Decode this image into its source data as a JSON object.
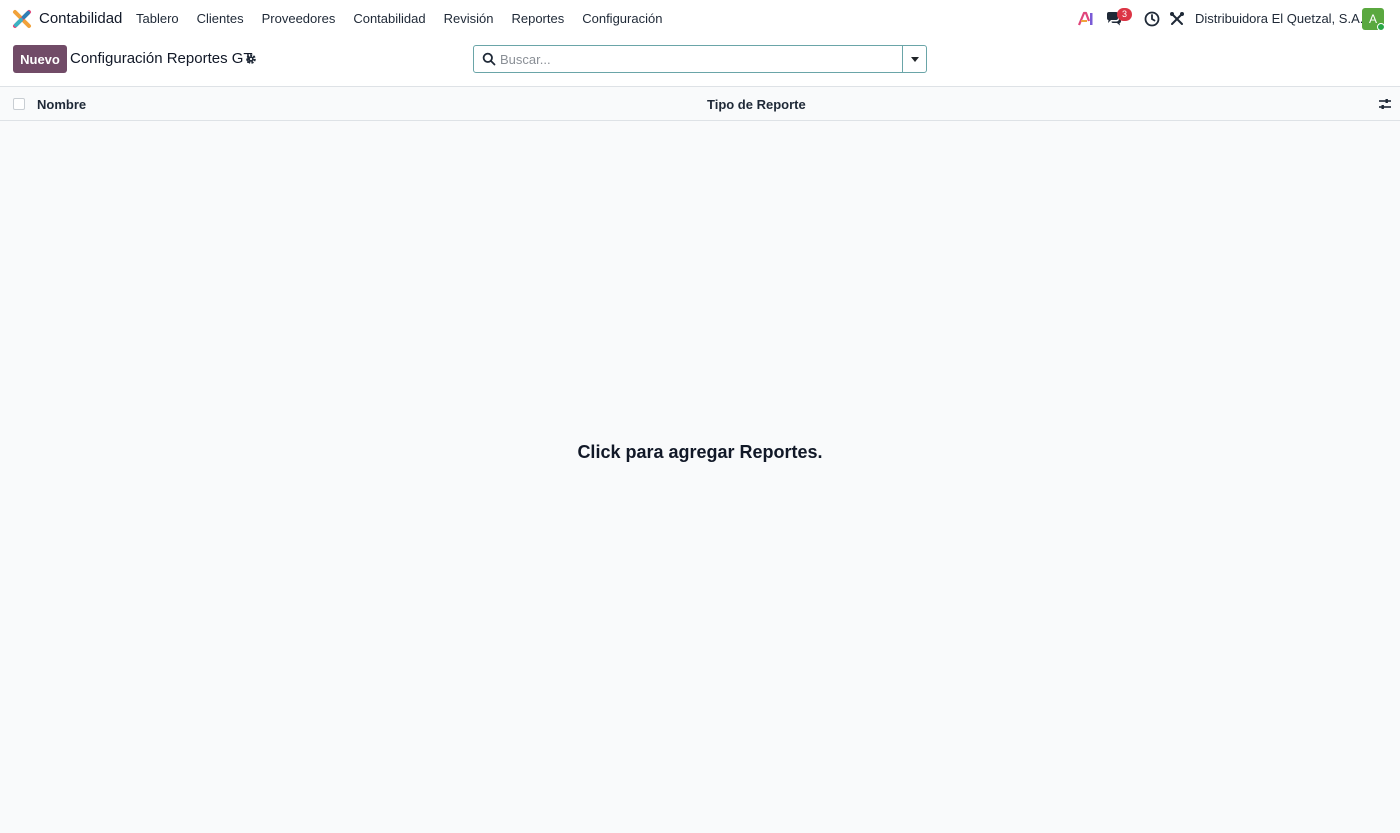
{
  "navbar": {
    "app_name": "Contabilidad",
    "menu": [
      {
        "label": "Tablero"
      },
      {
        "label": "Clientes"
      },
      {
        "label": "Proveedores"
      },
      {
        "label": "Contabilidad"
      },
      {
        "label": "Revisión"
      },
      {
        "label": "Reportes"
      },
      {
        "label": "Configuración"
      }
    ],
    "chat_badge": "3",
    "company": "Distribuidora El Quetzal, S.A.",
    "avatar_letter": "A"
  },
  "control_panel": {
    "new_button": "Nuevo",
    "title": "Configuración Reportes GT",
    "search_placeholder": "Buscar..."
  },
  "list": {
    "columns": [
      {
        "label": "Nombre"
      },
      {
        "label": "Tipo de Reporte"
      }
    ],
    "empty_message": "Click para agregar Reportes."
  },
  "colors": {
    "primary": "#714b67",
    "badge": "#dc3545",
    "avatar": "#5aa83f"
  }
}
